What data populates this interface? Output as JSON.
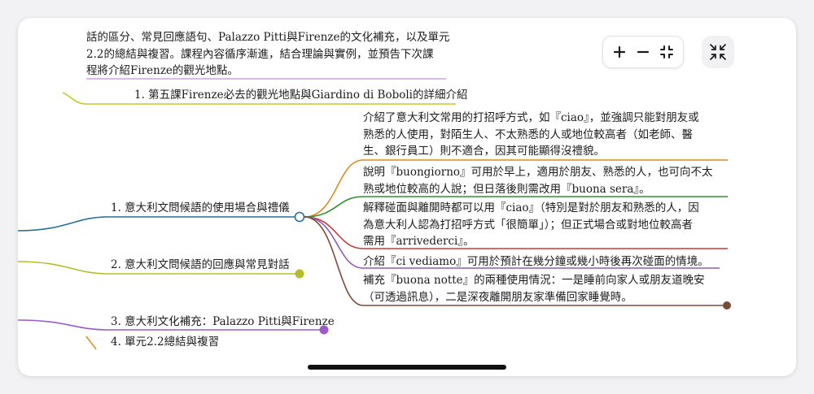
{
  "intro": {
    "lines": [
      "話的區分、常見回應語句、Palazzo Pitti與Firenze的文化補充，以及單元",
      "2.2的總結與複習。課程內容循序漸進，結合理論與實例，並預告下次課",
      "程將介紹Firenze的觀光地點。"
    ]
  },
  "topics": {
    "next_lesson": "1. 第五課Firenze必去的觀光地點與Giardino di Boboli的詳細介紹"
  },
  "branches": [
    {
      "label": "1. 意大利文問候語的使用場合與禮儀"
    },
    {
      "label": "2. 意大利文問候語的回應與常見對話"
    },
    {
      "label": "3. 意大利文化補充：Palazzo Pitti與Firenze"
    },
    {
      "label": "4. 單元2.2總結與複習"
    }
  ],
  "leaves": [
    {
      "lines": [
        "介紹了意大利文常用的打招呼方式，如『ciao』，並強調只能對朋友或",
        "熟悉的人使用，對陌生人、不太熟悉的人或地位較高者（如老師、醫",
        "生、銀行員工）則不適合，因其可能顯得沒禮貌。"
      ]
    },
    {
      "lines": [
        "說明『buongiorno』可用於早上，適用於朋友、熟悉的人，也可向不太",
        "熟或地位較高的人說；但日落後則需改用『buona sera』。"
      ]
    },
    {
      "lines": [
        "解釋碰面與離開時都可以用『ciao』（特別是對於朋友和熟悉的人，因",
        "為意大利人認為打招呼方式「很簡單」）；但正式場合或對地位較高者",
        "需用『arrivederci』。"
      ]
    },
    {
      "lines": [
        "介紹『ci vediamo』可用於預計在幾分鐘或幾小時後再次碰面的情境。"
      ]
    },
    {
      "lines": [
        "補充『buona notte』的兩種使用情況：一是睡前向家人或朋友道晚安",
        "（可透過訊息），二是深夜離開朋友家準備回家睡覺時。"
      ]
    }
  ],
  "controls": {
    "zoom_in_icon": "plus-icon",
    "zoom_out_icon": "minus-icon",
    "fit_icon": "fit-view-icon",
    "fullscreen_icon": "collapse-icon"
  },
  "colors": {
    "intro_underline": "#c9a3e0",
    "topic_underline": "#c7c92a",
    "branch1": "#2a6f97",
    "branch2": "#b5bd2a",
    "branch3": "#9a5cc9",
    "branch4": "#e2902a",
    "leaf1": "#e08a1e",
    "leaf2": "#2f8f2f",
    "leaf3": "#c83a3a",
    "leaf4": "#8e58c0",
    "leaf5": "#7a4b37"
  }
}
